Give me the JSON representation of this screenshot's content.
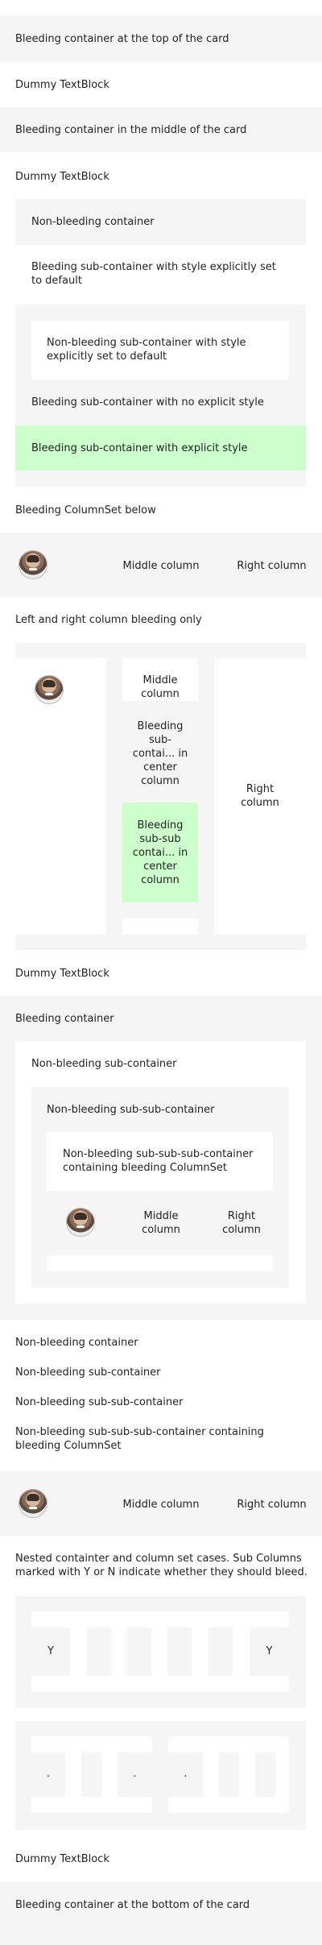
{
  "items": {
    "bleed_top": "Bleeding container at the top of the card",
    "dummy_1": "Dummy TextBlock",
    "bleed_middle": "Bleeding container in the middle of the card",
    "dummy_2": "Dummy TextBlock",
    "nonbleed_container": "Non-bleeding container",
    "bleed_sub_default": "Bleeding sub-container with style explicitly set to default",
    "nonbleed_sub_default": "Non-bleeding sub-container with style explicitly set to default",
    "bleed_sub_no_style": "Bleeding sub-container with no explicit style",
    "bleed_sub_explicit": "Bleeding sub-container with explicit style",
    "bleed_columnset_below": "Bleeding ColumnSet below",
    "cs1_middle": "Middle column",
    "cs1_right": "Right column",
    "lr_bleed_only": "Left and right column bleeding only",
    "cs2_middle": "Middle column",
    "cs2_bleed_sub": "Bleeding sub-contai... in center column",
    "cs2_bleed_subsub": "Bleeding sub-sub contai... in center column",
    "cs2_right": "Right column",
    "dummy_3": "Dummy TextBlock",
    "bleed_container": "Bleeding container",
    "nonbleed_sub": "Non-bleeding sub-container",
    "nonbleed_subsub": "Non-bleeding sub-sub-container",
    "nonbleed_subsubsub_cs": "Non-bleeding sub-sub-sub-container containing bleeding ColumnSet",
    "cs3_middle": "Middle column",
    "cs3_right": "Right column",
    "nb_container": "Non-bleeding container",
    "nb_sub": "Non-bleeding sub-container",
    "nb_subsub": "Non-bleeding sub-sub-container",
    "nb_subsubsub_cs": "Non-bleeding sub-sub-sub-container containing bleeding ColumnSet",
    "cs4_middle": "Middle column",
    "cs4_right": "Right column",
    "nested_note": "Nested containter and column set cases. Sub Columns marked with Y or N indicate whether they should bleed.",
    "y_left": "Y",
    "y_right": "Y",
    "dot_1": ".",
    "dot_2": ".",
    "dot_3": ".",
    "dummy_4": "Dummy TextBlock",
    "bleed_bottom": "Bleeding container at the bottom of the card"
  },
  "colors": {
    "emphasis": "#f5f5f5",
    "default": "#ffffff",
    "good": "#ccffcc",
    "text": "#222222"
  },
  "icons": {
    "avatar": "person-avatar-icon"
  }
}
